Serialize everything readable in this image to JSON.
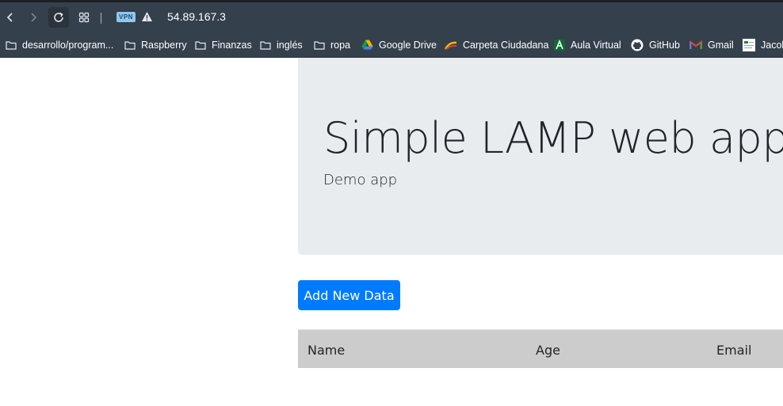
{
  "browser": {
    "vpn_badge": "VPN",
    "url": "54.89.167.3",
    "bookmarks": [
      {
        "label": "desarrollo/program...",
        "icon": "folder-icon"
      },
      {
        "label": "Raspberry",
        "icon": "folder-icon"
      },
      {
        "label": "Finanzas",
        "icon": "folder-icon"
      },
      {
        "label": "inglés",
        "icon": "folder-icon"
      },
      {
        "label": "ropa",
        "icon": "folder-icon"
      },
      {
        "label": "Google Drive",
        "icon": "google-drive-icon"
      },
      {
        "label": "Carpeta Ciudadana",
        "icon": "carpeta-ciudadana-icon"
      },
      {
        "label": "Aula Virtual",
        "icon": "aula-virtual-icon"
      },
      {
        "label": "GitHub",
        "icon": "github-icon"
      },
      {
        "label": "Gmail",
        "icon": "gmail-icon"
      },
      {
        "label": "Jacob",
        "icon": "site-icon"
      }
    ]
  },
  "page": {
    "title": "Simple LAMP web app",
    "subtitle": "Demo app",
    "add_button": "Add New Data",
    "table": {
      "headers": [
        "Name",
        "Age",
        "Email"
      ]
    }
  },
  "colors": {
    "toolbar": "#35404d",
    "jumbotron": "#e9ecef",
    "primary": "#007bff",
    "table_header": "#cccccc"
  }
}
